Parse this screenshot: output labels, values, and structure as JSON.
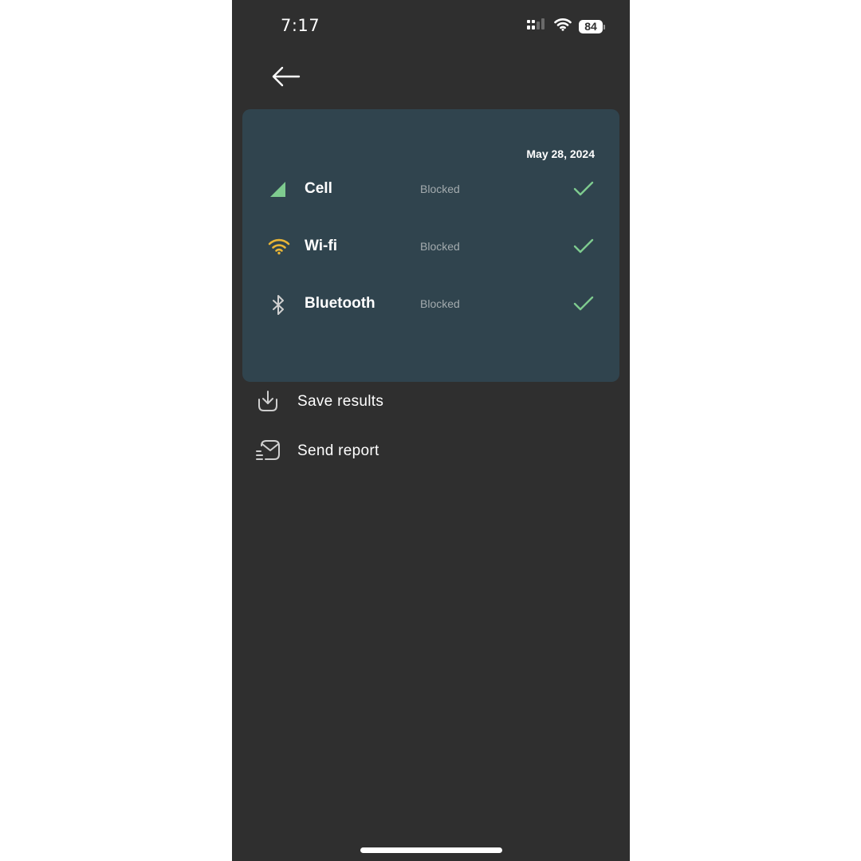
{
  "status_bar": {
    "time": "7:17",
    "battery": "84",
    "icons": [
      "cellular-signal-icon",
      "wifi-icon",
      "battery-icon"
    ]
  },
  "header": {
    "back_icon": "arrow-left-icon"
  },
  "results_card": {
    "date": "May 28, 2024",
    "rows": [
      {
        "icon": "cell-signal-icon",
        "label": "Cell",
        "status": "Blocked",
        "result_icon": "checkmark-icon"
      },
      {
        "icon": "wifi-icon",
        "label": "Wi-fi",
        "status": "Blocked",
        "result_icon": "checkmark-icon"
      },
      {
        "icon": "bluetooth-icon",
        "label": "Bluetooth",
        "status": "Blocked",
        "result_icon": "checkmark-icon"
      }
    ]
  },
  "actions": [
    {
      "icon": "download-icon",
      "label": "Save results"
    },
    {
      "icon": "mail-send-icon",
      "label": "Send report"
    }
  ],
  "colors": {
    "background": "#2f2f2f",
    "card": "#30444e",
    "cell_icon": "#7ecb8f",
    "wifi_icon": "#e8b536",
    "check": "#7ecb8f",
    "status_text": "#a3abae"
  }
}
